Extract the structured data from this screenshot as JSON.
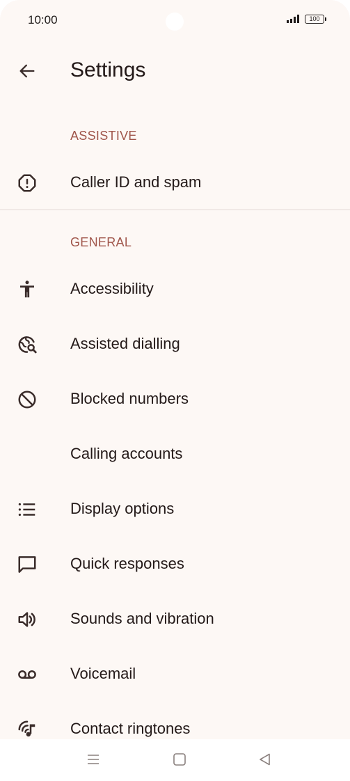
{
  "status": {
    "time": "10:00",
    "battery": "100"
  },
  "header": {
    "title": "Settings",
    "back_icon": "arrow-back-icon"
  },
  "sections": {
    "assistive": {
      "title": "ASSISTIVE"
    },
    "general": {
      "title": "GENERAL"
    }
  },
  "items": {
    "caller_id": {
      "label": "Caller ID and spam",
      "icon": "spam-alert-icon"
    },
    "accessibility": {
      "label": "Accessibility",
      "icon": "accessibility-icon"
    },
    "assisted_dialling": {
      "label": "Assisted dialling",
      "icon": "globe-search-icon"
    },
    "blocked_numbers": {
      "label": "Blocked numbers",
      "icon": "block-icon"
    },
    "calling_accounts": {
      "label": "Calling accounts",
      "icon": ""
    },
    "display_options": {
      "label": "Display options",
      "icon": "list-icon"
    },
    "quick_responses": {
      "label": "Quick responses",
      "icon": "chat-bubble-icon"
    },
    "sounds_vibration": {
      "label": "Sounds and vibration",
      "icon": "volume-icon"
    },
    "voicemail": {
      "label": "Voicemail",
      "icon": "voicemail-icon"
    },
    "contact_ringtones": {
      "label": "Contact ringtones",
      "icon": "ringtone-icon"
    }
  },
  "colors": {
    "background": "#fdf8f5",
    "section_header": "#a0564b",
    "text": "#231918",
    "icon": "#3a2c2a"
  },
  "nav": {
    "menu_icon": "menu-icon",
    "home_icon": "home-icon",
    "back_icon": "triangle-back-icon"
  }
}
